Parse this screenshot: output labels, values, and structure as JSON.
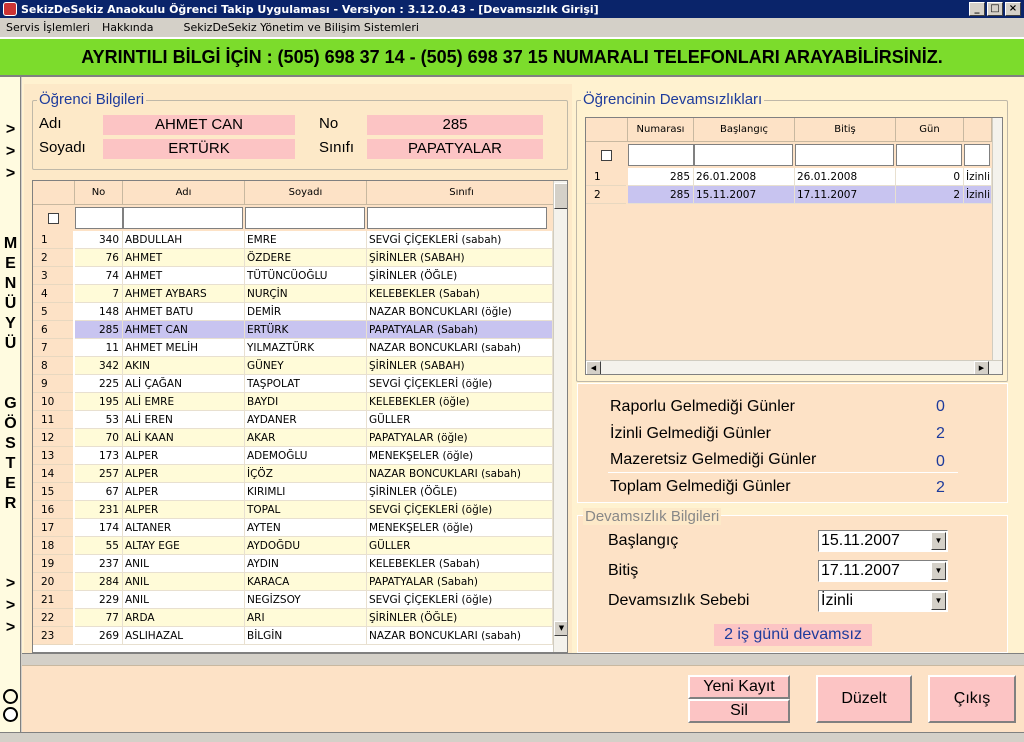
{
  "window": {
    "title": "SekizDeSekiz Anaokulu Öğrenci Takip Uygulaması - Versiyon : 3.12.0.43 - [Devamsızlık Girişi]"
  },
  "menu": [
    "Servis İşlemleri",
    "Hakkında",
    "SekizDeSekiz Yönetim ve Bilişim Sistemleri"
  ],
  "banner": "AYRINTILI BİLGİ İÇİN : (505) 698 37 14 - (505) 698 37 15 NUMARALI TELEFONLARI ARAYABİLİRSİNİZ.",
  "sidebar": {
    "top_arrows": [
      ">",
      ">",
      ">"
    ],
    "menu_letters": [
      "M",
      "E",
      "N",
      "Ü",
      "Y",
      "Ü"
    ],
    "show_letters": [
      "G",
      "Ö",
      "S",
      "T",
      "E",
      "R"
    ],
    "bottom_arrows": [
      ">",
      ">",
      ">"
    ]
  },
  "student": {
    "group_title": "Öğrenci Bilgileri",
    "ad_label": "Adı",
    "ad": "AHMET CAN",
    "soyad_label": "Soyadı",
    "soyad": "ERTÜRK",
    "no_label": "No",
    "no": "285",
    "sinif_label": "Sınıfı",
    "sinif": "PAPATYALAR"
  },
  "student_grid": {
    "columns": [
      "No",
      "Adı",
      "Soyadı",
      "Sınıfı"
    ],
    "selected_index": 5,
    "rows": [
      [
        "1",
        "340",
        "ABDULLAH",
        "EMRE",
        "SEVGİ ÇİÇEKLERİ (sabah)"
      ],
      [
        "2",
        "76",
        "AHMET",
        "ÖZDERE",
        "ŞİRİNLER (SABAH)"
      ],
      [
        "3",
        "74",
        "AHMET",
        "TÜTÜNCÜOĞLU",
        "ŞİRİNLER (ÖĞLE)"
      ],
      [
        "4",
        "7",
        "AHMET AYBARS",
        "NURÇİN",
        "KELEBEKLER (Sabah)"
      ],
      [
        "5",
        "148",
        "AHMET BATU",
        "DEMİR",
        "NAZAR BONCUKLARI (öğle)"
      ],
      [
        "6",
        "285",
        "AHMET CAN",
        "ERTÜRK",
        "PAPATYALAR (Sabah)"
      ],
      [
        "7",
        "11",
        "AHMET MELİH",
        "YILMAZTÜRK",
        "NAZAR BONCUKLARI (sabah)"
      ],
      [
        "8",
        "342",
        "AKIN",
        "GÜNEY",
        "ŞİRİNLER (SABAH)"
      ],
      [
        "9",
        "225",
        "ALİ ÇAĞAN",
        "TAŞPOLAT",
        "SEVGİ ÇİÇEKLERİ (öğle)"
      ],
      [
        "10",
        "195",
        "ALİ EMRE",
        "BAYDI",
        "KELEBEKLER (öğle)"
      ],
      [
        "11",
        "53",
        "ALİ EREN",
        "AYDANER",
        "GÜLLER"
      ],
      [
        "12",
        "70",
        "ALİ KAAN",
        "AKAR",
        "PAPATYALAR (öğle)"
      ],
      [
        "13",
        "173",
        "ALPER",
        "ADEMOĞLU",
        "MENEKŞELER (öğle)"
      ],
      [
        "14",
        "257",
        "ALPER",
        "İÇÖZ",
        "NAZAR BONCUKLARI (sabah)"
      ],
      [
        "15",
        "67",
        "ALPER",
        "KIRIMLI",
        "ŞİRİNLER (ÖĞLE)"
      ],
      [
        "16",
        "231",
        "ALPER",
        "TOPAL",
        "SEVGİ ÇİÇEKLERİ (öğle)"
      ],
      [
        "17",
        "174",
        "ALTANER",
        "AYTEN",
        "MENEKŞELER (öğle)"
      ],
      [
        "18",
        "55",
        "ALTAY EGE",
        "AYDOĞDU",
        "GÜLLER"
      ],
      [
        "19",
        "237",
        "ANIL",
        "AYDIN",
        "KELEBEKLER (Sabah)"
      ],
      [
        "20",
        "284",
        "ANIL",
        "KARACA",
        "PAPATYALAR (Sabah)"
      ],
      [
        "21",
        "229",
        "ANIL",
        "NEGİZSOY",
        "SEVGİ ÇİÇEKLERİ (öğle)"
      ],
      [
        "22",
        "77",
        "ARDA",
        "ARI",
        "ŞİRİNLER (ÖĞLE)"
      ],
      [
        "23",
        "269",
        "ASLIHAZAL",
        "BİLGİN",
        "NAZAR BONCUKLARI (sabah)"
      ]
    ]
  },
  "absences": {
    "group_title": "Öğrencinin Devamsızlıkları",
    "columns": [
      "Numarası",
      "Başlangıç",
      "Bitiş",
      "Gün",
      ""
    ],
    "rows": [
      [
        "1",
        "285",
        "26.01.2008",
        "26.01.2008",
        "0",
        "İzinli"
      ],
      [
        "2",
        "285",
        "15.11.2007",
        "17.11.2007",
        "2",
        "İzinli"
      ]
    ]
  },
  "summary": [
    {
      "label": "Raporlu Gelmediği Günler",
      "value": "0"
    },
    {
      "label": "İzinli Gelmediği Günler",
      "value": "2"
    },
    {
      "label": "Mazeretsiz Gelmediği Günler",
      "value": "0"
    },
    {
      "label": "Toplam Gelmediği Günler",
      "value": "2"
    }
  ],
  "absence_info": {
    "group_title": "Devamsızlık Bilgileri",
    "start_label": "Başlangıç",
    "start": "15.11.2007",
    "end_label": "Bitiş",
    "end": "17.11.2007",
    "reason_label": "Devamsızlık Sebebi",
    "reason": "İzinli",
    "note": "2 iş günü devamsız"
  },
  "buttons": {
    "new": "Yeni Kayıt",
    "delete": "Sil",
    "edit": "Düzelt",
    "exit": "Çıkış"
  },
  "colors": {
    "banner": "#7cdc2c",
    "pink": "#fcc4c4",
    "selected": "#c8c4f0",
    "accent": "#1d3b9c"
  }
}
